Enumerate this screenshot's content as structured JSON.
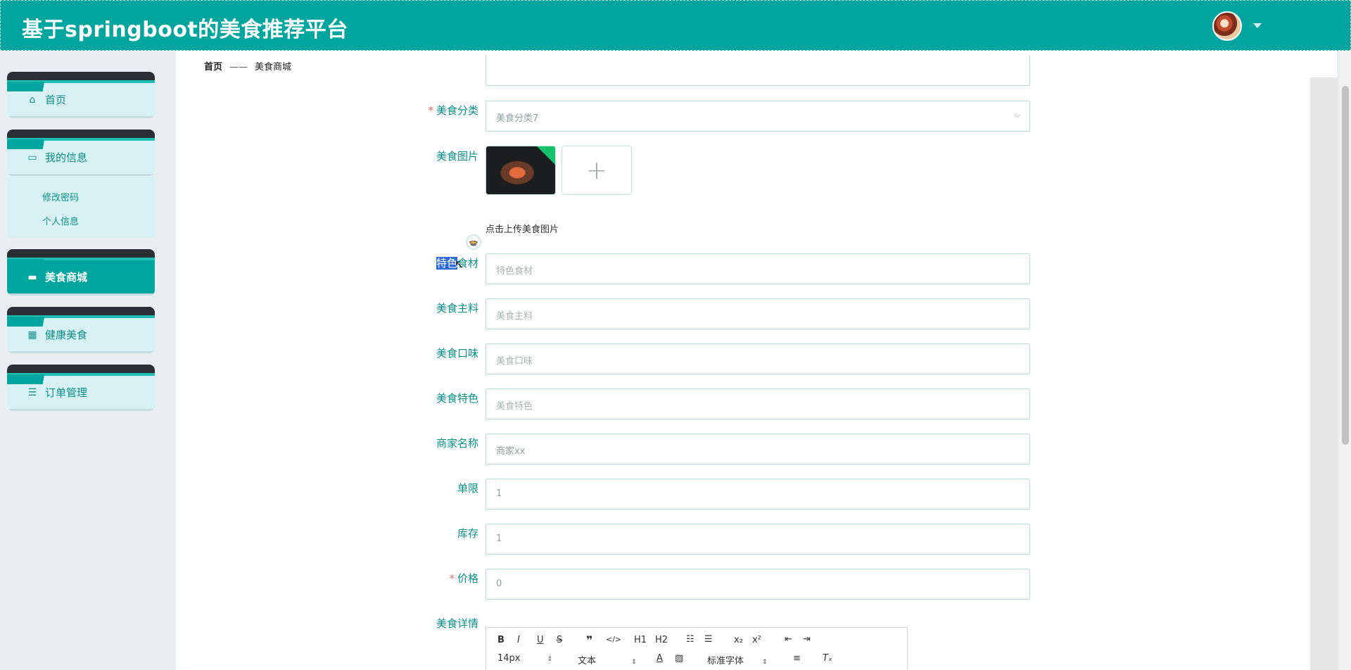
{
  "header": {
    "title": "基于springboot的美食推荐平台"
  },
  "sidebar": {
    "items": [
      {
        "label": "首页",
        "icon": "home-icon"
      },
      {
        "label": "我的信息",
        "icon": "card-icon"
      },
      {
        "label": "美食商城",
        "icon": "monitor-icon"
      },
      {
        "label": "健康美食",
        "icon": "grid-icon"
      },
      {
        "label": "订单管理",
        "icon": "list-icon"
      }
    ],
    "submenu": [
      "修改密码",
      "个人信息"
    ]
  },
  "breadcrumb": {
    "home": "首页",
    "sep": "——",
    "current": "美食商城"
  },
  "form": {
    "category_label": "美食分类",
    "category_value": "美食分类7",
    "image_label": "美食图片",
    "upload_hint": "点击上传美食图片",
    "ingredient_label_highlight": "特色",
    "ingredient_label_rest": "食材",
    "ingredient_placeholder": "特色食材",
    "main_label": "美食主料",
    "main_placeholder": "美食主料",
    "taste_label": "美食口味",
    "taste_placeholder": "美食口味",
    "feature_label": "美食特色",
    "feature_placeholder": "美食特色",
    "merchant_label": "商家名称",
    "merchant_value": "商家xx",
    "limit_label": "单限",
    "limit_value": "1",
    "stock_label": "库存",
    "stock_value": "1",
    "price_label": "价格",
    "price_value": "0",
    "detail_label": "美食详情",
    "required_mark": "*"
  },
  "editor": {
    "font_size": "14px",
    "text_type": "文本",
    "font_family": "标准字体",
    "buttons": [
      "B",
      "I",
      "U",
      "S",
      "❞",
      "</>",
      "H1",
      "H2"
    ]
  }
}
